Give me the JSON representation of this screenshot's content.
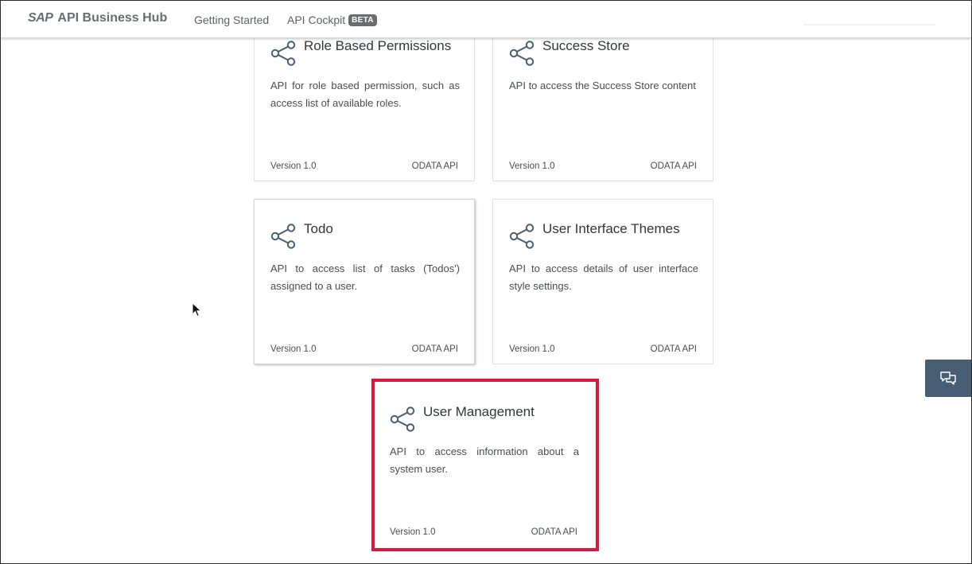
{
  "header": {
    "brand_logo": "SAP",
    "brand_title": "API Business Hub",
    "nav": [
      {
        "label": "Getting Started"
      },
      {
        "label": "API Cockpit",
        "badge": "BETA"
      }
    ]
  },
  "cards": [
    {
      "title": "Role Based Permissions",
      "description": "API for role based permission, such as access list of available roles.",
      "version": "Version 1.0",
      "type": "ODATA API",
      "icon": "share-icon"
    },
    {
      "title": "Success Store",
      "description": "API to access the Success Store content",
      "version": "Version 1.0",
      "type": "ODATA API",
      "icon": "share-icon"
    },
    {
      "title": "Todo",
      "description": "API to access list of tasks (Todos') assigned to a user.",
      "version": "Version 1.0",
      "type": "ODATA API",
      "icon": "share-icon"
    },
    {
      "title": "User Interface Themes",
      "description": "API to access details of user interface style settings.",
      "version": "Version 1.0",
      "type": "ODATA API",
      "icon": "share-icon"
    },
    {
      "title": "User Management",
      "description": "API to access information about a system user.",
      "version": "Version 1.0",
      "type": "ODATA API",
      "icon": "share-icon",
      "highlighted": true
    }
  ],
  "feedback": {
    "icon": "chat-icon"
  },
  "colors": {
    "highlight": "#e0163e",
    "feedback_bg": "#475e75",
    "icon": "#475e75"
  }
}
